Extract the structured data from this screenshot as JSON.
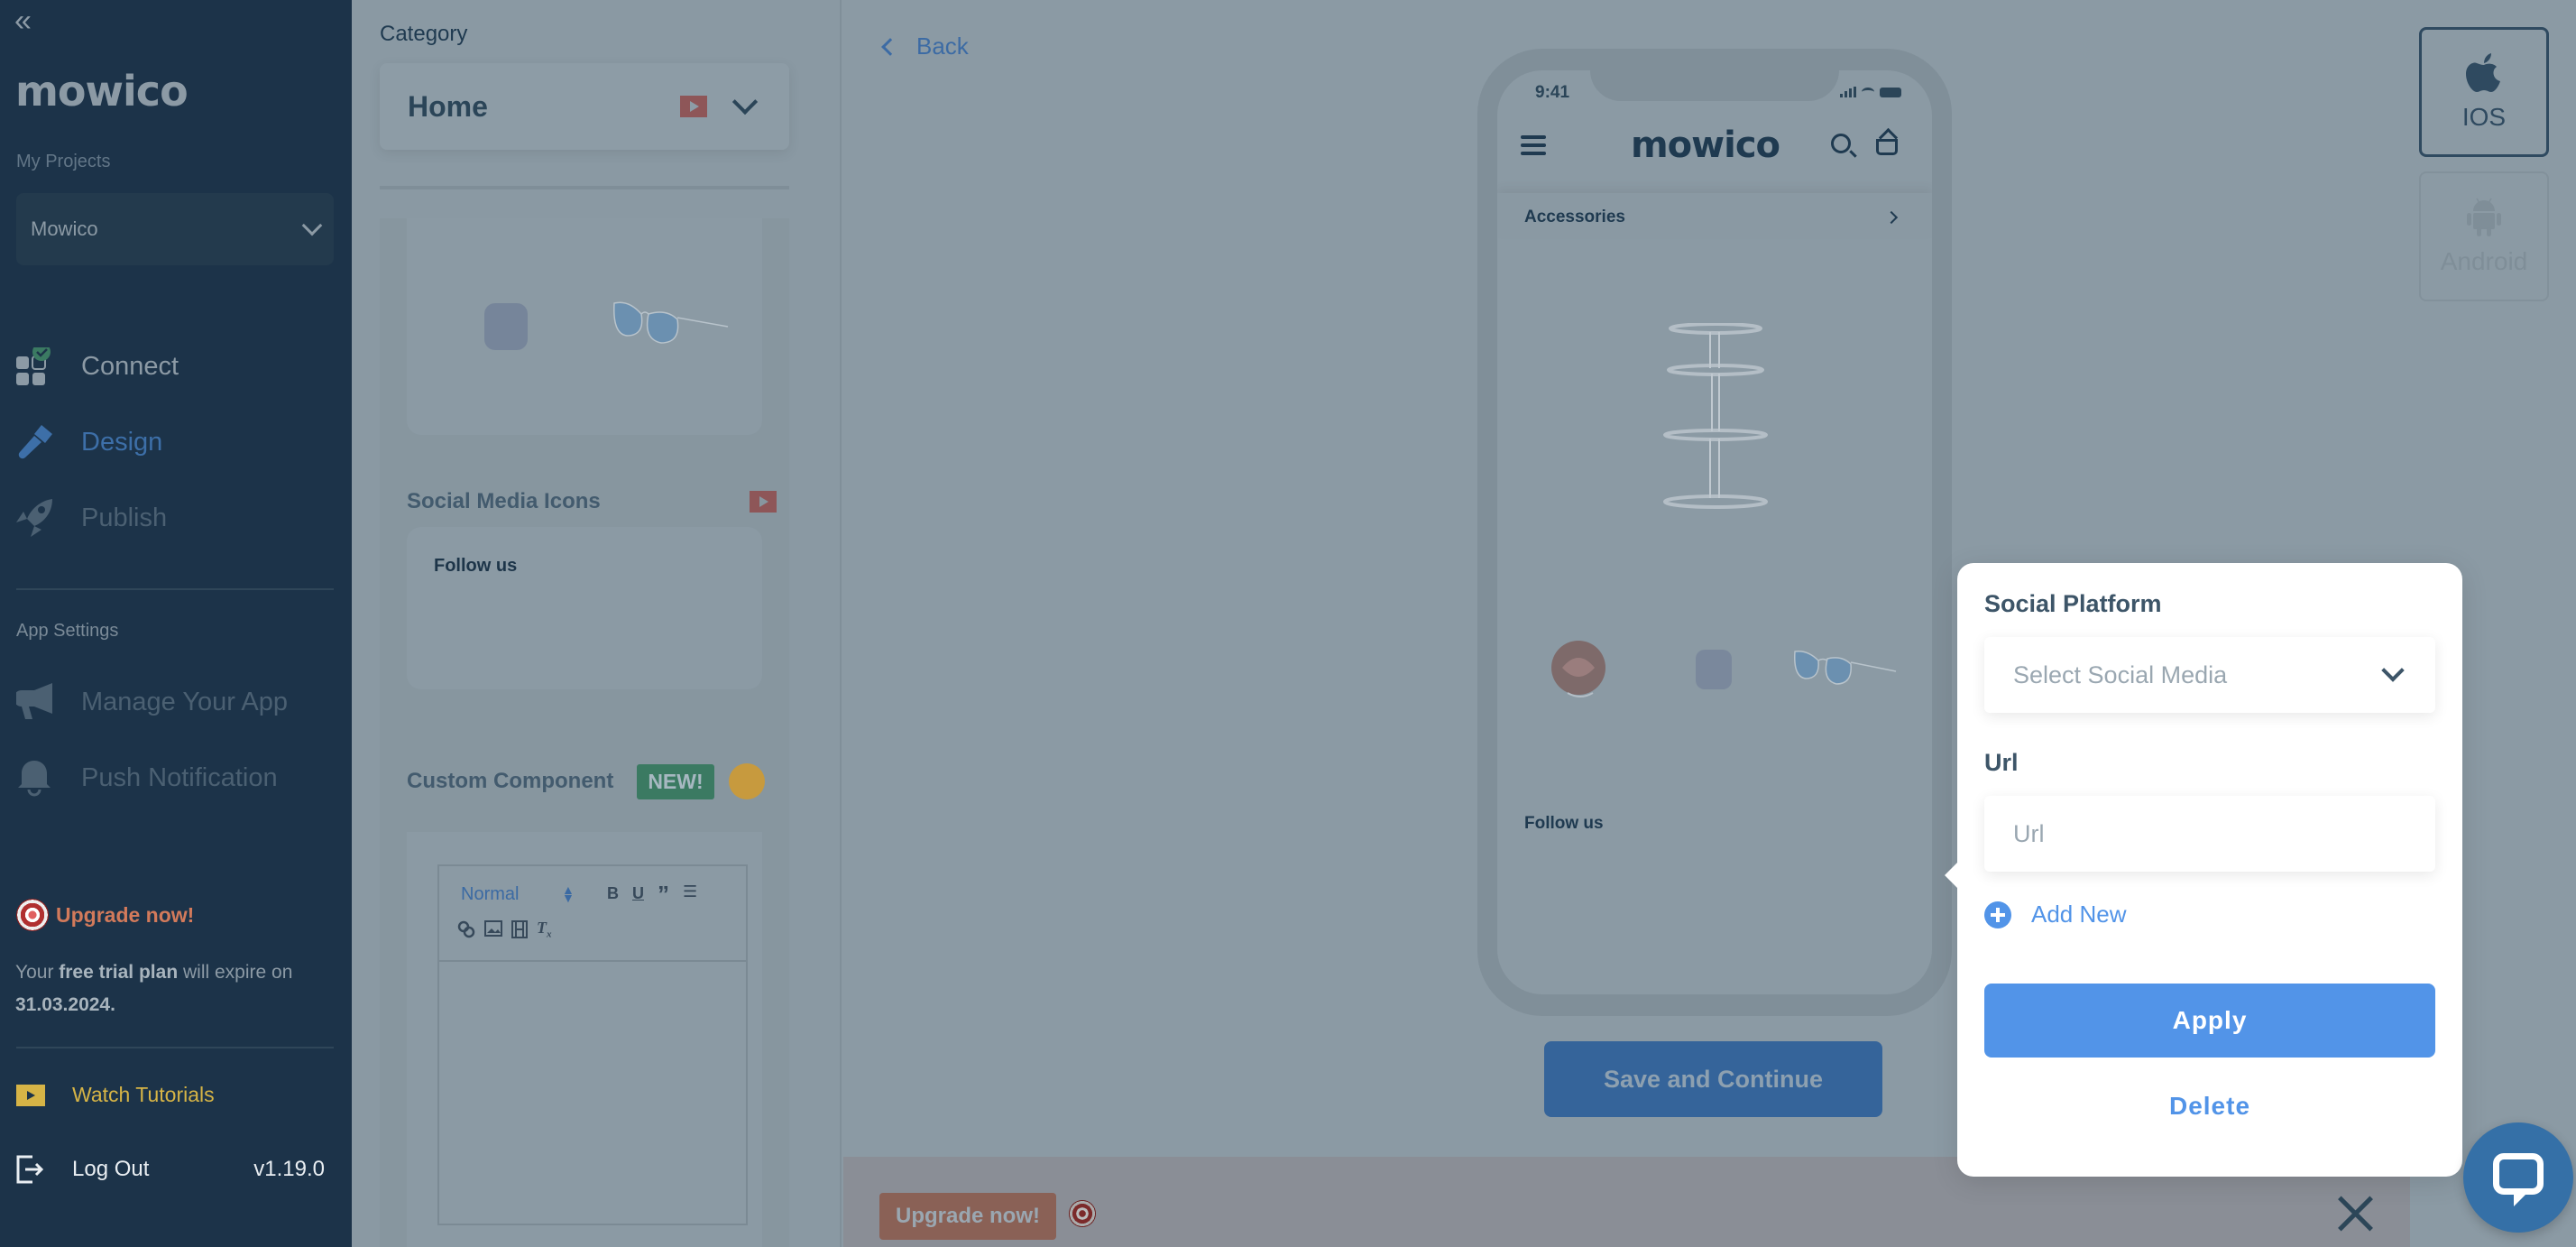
{
  "sidebar": {
    "collapse_icon": "double-chevron-left-icon",
    "logo": "mowico",
    "projects_label": "My Projects",
    "project_selected": "Mowico",
    "nav": [
      {
        "label": "Connect",
        "icon": "grid-check-icon",
        "state": "completed"
      },
      {
        "label": "Design",
        "icon": "paintbrush-icon",
        "state": "active"
      },
      {
        "label": "Publish",
        "icon": "rocket-icon",
        "state": "disabled"
      }
    ],
    "app_settings_label": "App Settings",
    "settings": [
      {
        "label": "Manage Your App",
        "icon": "megaphone-icon"
      },
      {
        "label": "Push Notification",
        "icon": "bell-icon"
      }
    ],
    "upgrade_label": "Upgrade now!",
    "trial_prefix": "Your ",
    "trial_bold": "free trial plan",
    "trial_suffix": " will expire on",
    "trial_date": "31.03.2024.",
    "watch_tutorials": "Watch Tutorials",
    "logout": "Log Out",
    "version": "v1.19.0"
  },
  "panel": {
    "category_label": "Category",
    "category_value": "Home",
    "social_title": "Social Media Icons",
    "follow_text": "Follow us",
    "custom_title": "Custom Component",
    "new_badge": "NEW!",
    "editor": {
      "format": "Normal",
      "buttons": [
        "B",
        "U",
        "”",
        "☰",
        "link",
        "image",
        "video",
        "clear-format"
      ]
    }
  },
  "main": {
    "back_label": "Back",
    "phone": {
      "time": "9:41",
      "logo": "mowico",
      "category": "Accessories",
      "follow_text": "Follow us"
    },
    "save_button": "Save and Continue",
    "platforms": [
      {
        "label": "IOS",
        "icon": "apple-icon",
        "selected": true
      },
      {
        "label": "Android",
        "icon": "android-icon",
        "selected": false
      }
    ],
    "banner": {
      "upgrade_button": "Upgrade now!"
    }
  },
  "popup": {
    "platform_label": "Social Platform",
    "platform_placeholder": "Select Social Media",
    "url_label": "Url",
    "url_placeholder": "Url",
    "url_value": "",
    "add_new": "Add New",
    "apply": "Apply",
    "delete": "Delete"
  },
  "colors": {
    "accent": "#5294e8",
    "sidebar_bg": "#1c3349",
    "overlay_bg": "#8b9aa4",
    "upgrade": "#d27a5b",
    "tutorials": "#d6b446",
    "new_badge": "#3b7a62"
  }
}
